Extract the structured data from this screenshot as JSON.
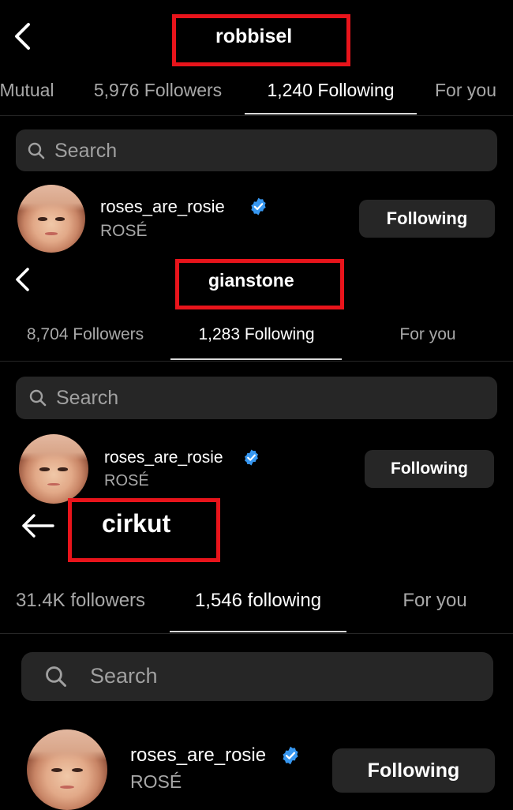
{
  "colors": {
    "background": "#000000",
    "highlight_box": "#e8141b",
    "verified": "#3797f0",
    "button_bg": "#262626"
  },
  "panels": [
    {
      "back_icon": "chevron-left-icon",
      "title": "robbisel",
      "tabs": [
        "Mutual",
        "5,976 Followers",
        "1,240 Following",
        "For you"
      ],
      "active_tab": "1,240 Following",
      "search_placeholder": "Search",
      "user": {
        "username": "roses_are_rosie",
        "full_name": "ROSÉ",
        "verified": true,
        "button": "Following"
      }
    },
    {
      "back_icon": "chevron-left-icon",
      "title": "gianstone",
      "tabs": [
        "8,704 Followers",
        "1,283 Following",
        "For you"
      ],
      "active_tab": "1,283 Following",
      "search_placeholder": "Search",
      "user": {
        "username": "roses_are_rosie",
        "full_name": "ROSÉ",
        "verified": true,
        "button": "Following"
      }
    },
    {
      "back_icon": "arrow-left-icon",
      "title": "cirkut",
      "tabs": [
        "31.4K followers",
        "1,546 following",
        "For you"
      ],
      "active_tab": "1,546 following",
      "search_placeholder": "Search",
      "user": {
        "username": "roses_are_rosie",
        "full_name": "ROSÉ",
        "verified": true,
        "button": "Following"
      }
    }
  ]
}
